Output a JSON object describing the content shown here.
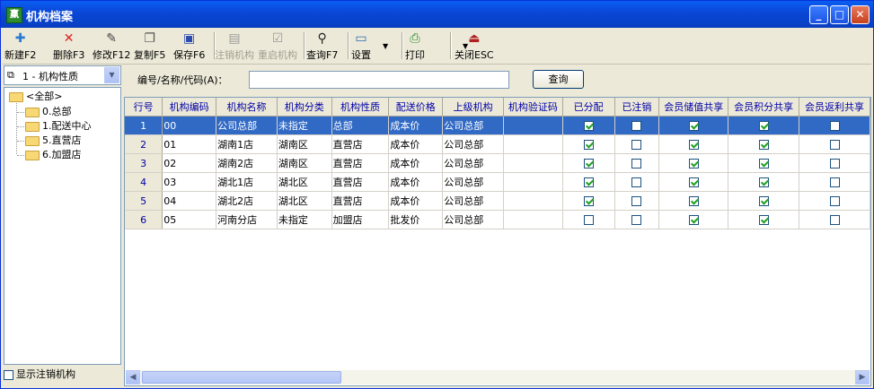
{
  "window": {
    "title": "机构档案",
    "min": "_",
    "max": "□",
    "close": "✕"
  },
  "toolbar": [
    {
      "label": "新建F2",
      "icon": "new-icon",
      "glyph": "✚",
      "color": "#2a7ad4",
      "enabled": true
    },
    {
      "label": "删除F3",
      "icon": "delete-icon",
      "glyph": "✕",
      "color": "#e02020",
      "enabled": true
    },
    {
      "label": "修改F12",
      "icon": "edit-icon",
      "glyph": "✎",
      "color": "#444",
      "enabled": true
    },
    {
      "label": "复制F5",
      "icon": "copy-icon",
      "glyph": "❐",
      "color": "#555",
      "enabled": true
    },
    {
      "label": "保存F6",
      "icon": "save-icon",
      "glyph": "▣",
      "color": "#2b4bb0",
      "enabled": true
    },
    {
      "label": "注销机构",
      "icon": "deregister-icon",
      "glyph": "▤",
      "color": "#9a9a9a",
      "enabled": false
    },
    {
      "label": "重启机构",
      "icon": "restart-icon",
      "glyph": "☑",
      "color": "#9a9a9a",
      "enabled": false
    },
    {
      "label": "查询F7",
      "icon": "binoculars-icon",
      "glyph": "⚲",
      "color": "#222",
      "enabled": true
    },
    {
      "label": "设置",
      "icon": "settings-icon",
      "glyph": "▭",
      "color": "#2b6cb0",
      "enabled": true
    },
    {
      "label": "打印",
      "icon": "print-icon",
      "glyph": "⎙",
      "color": "#2a8a2a",
      "enabled": true
    },
    {
      "label": "关闭ESC",
      "icon": "exit-icon",
      "glyph": "⏏",
      "color": "#b02020",
      "enabled": true
    }
  ],
  "left": {
    "combo_value": "1 - 机构性质",
    "tree_root": "<全部>",
    "tree_items": [
      "0.总部",
      "1.配送中心",
      "5.直营店",
      "6.加盟店"
    ],
    "show_deregistered_label": "显示注销机构",
    "show_deregistered": false
  },
  "search": {
    "label": "编号/名称/代码(A)：",
    "value": "",
    "button": "查询"
  },
  "columns": [
    "行号",
    "机构编码",
    "机构名称",
    "机构分类",
    "机构性质",
    "配送价格",
    "上级机构",
    "机构验证码",
    "已分配",
    "已注销",
    "会员储值共享",
    "会员积分共享",
    "会员返利共享"
  ],
  "rows": [
    {
      "n": "1",
      "code": "00",
      "name": "公司总部",
      "cat": "未指定",
      "nature": "总部",
      "price": "成本价",
      "parent": "公司总部",
      "verify": "",
      "assigned": true,
      "cancelled": false,
      "stored": true,
      "points": true,
      "rebate": false
    },
    {
      "n": "2",
      "code": "01",
      "name": "湖南1店",
      "cat": "湖南区",
      "nature": "直营店",
      "price": "成本价",
      "parent": "公司总部",
      "verify": "",
      "assigned": true,
      "cancelled": false,
      "stored": true,
      "points": true,
      "rebate": false
    },
    {
      "n": "3",
      "code": "02",
      "name": "湖南2店",
      "cat": "湖南区",
      "nature": "直营店",
      "price": "成本价",
      "parent": "公司总部",
      "verify": "",
      "assigned": true,
      "cancelled": false,
      "stored": true,
      "points": true,
      "rebate": false
    },
    {
      "n": "4",
      "code": "03",
      "name": "湖北1店",
      "cat": "湖北区",
      "nature": "直营店",
      "price": "成本价",
      "parent": "公司总部",
      "verify": "",
      "assigned": true,
      "cancelled": false,
      "stored": true,
      "points": true,
      "rebate": false
    },
    {
      "n": "5",
      "code": "04",
      "name": "湖北2店",
      "cat": "湖北区",
      "nature": "直营店",
      "price": "成本价",
      "parent": "公司总部",
      "verify": "",
      "assigned": true,
      "cancelled": false,
      "stored": true,
      "points": true,
      "rebate": false
    },
    {
      "n": "6",
      "code": "05",
      "name": "河南分店",
      "cat": "未指定",
      "nature": "加盟店",
      "price": "批发价",
      "parent": "公司总部",
      "verify": "",
      "assigned": false,
      "cancelled": false,
      "stored": true,
      "points": true,
      "rebate": false
    }
  ],
  "selected_row": 0
}
